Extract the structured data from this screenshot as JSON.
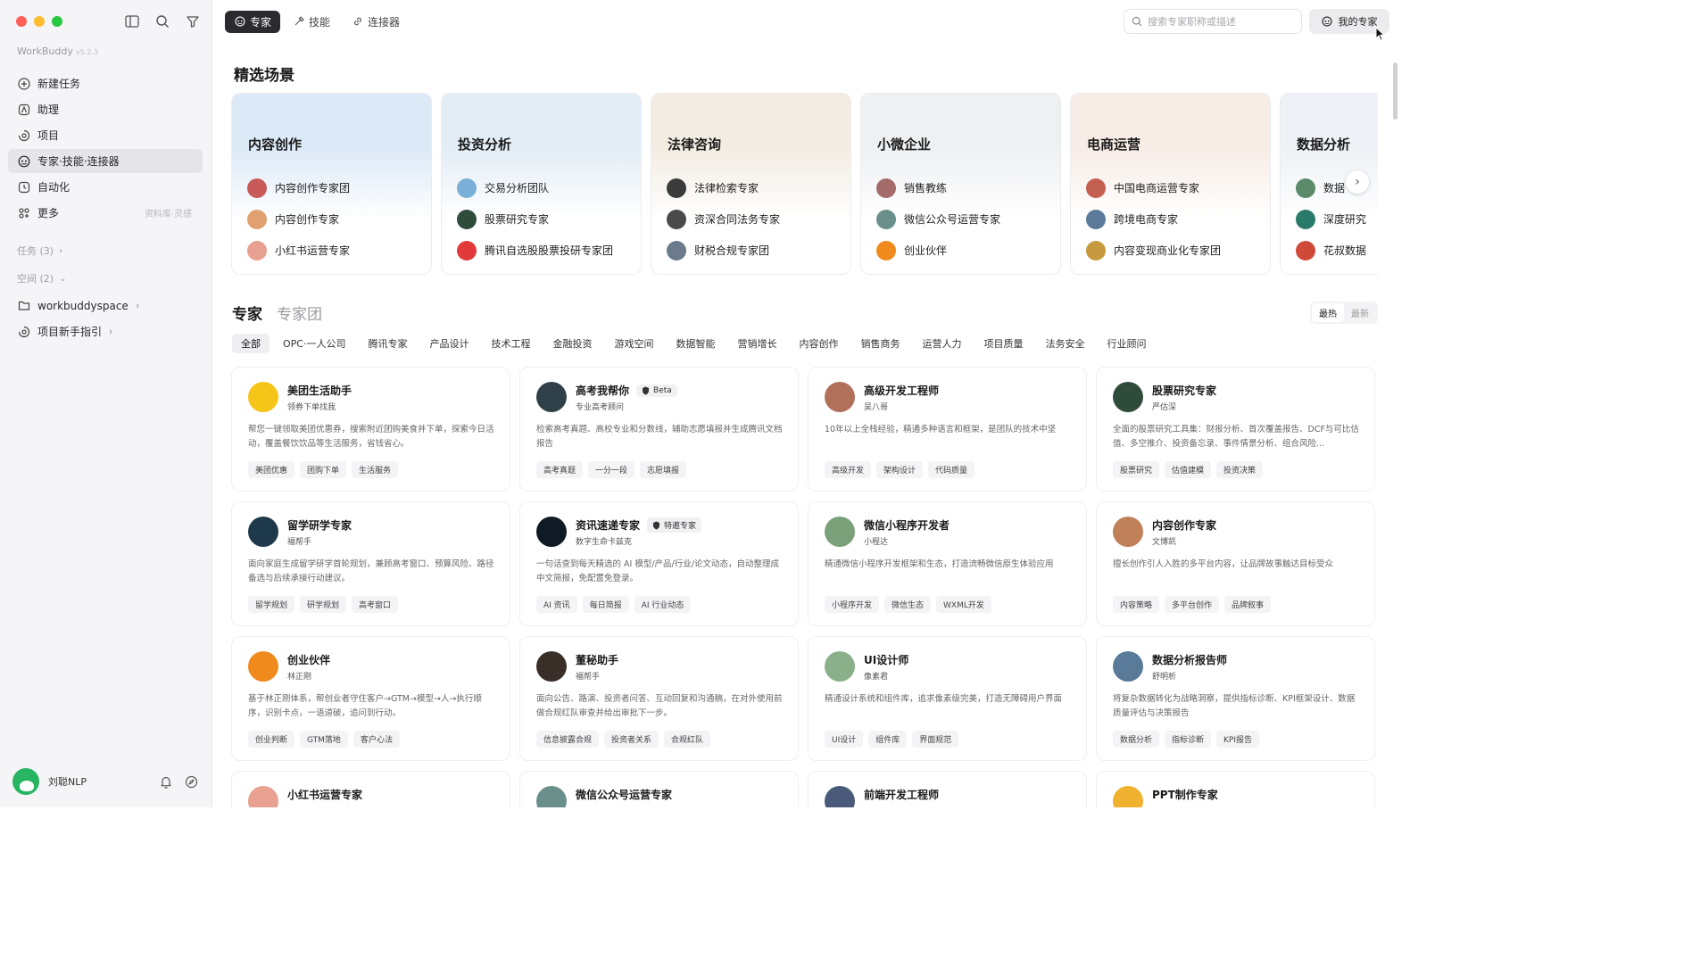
{
  "sidebar": {
    "brand": "WorkBuddy",
    "version": "v5.2.3",
    "nav": [
      {
        "label": "新建任务",
        "icon": "plus-circle-icon"
      },
      {
        "label": "助理",
        "icon": "assistant-icon"
      },
      {
        "label": "项目",
        "icon": "project-icon"
      },
      {
        "label": "专家·技能·连接器",
        "icon": "expert-icon",
        "active": true
      },
      {
        "label": "自动化",
        "icon": "automation-icon"
      },
      {
        "label": "更多",
        "icon": "more-icon",
        "hint": "资料库·灵感"
      }
    ],
    "tasks_label": "任务 (3)",
    "spaces_label": "空间 (2)",
    "workspaces": [
      {
        "label": "workbuddyspace",
        "icon": "folder-icon"
      },
      {
        "label": "项目新手指引",
        "icon": "project-icon"
      }
    ],
    "user": {
      "name": "刘聪NLP"
    }
  },
  "topbar": {
    "tabs": [
      {
        "label": "专家",
        "icon": "expert-icon",
        "active": true
      },
      {
        "label": "技能",
        "icon": "skill-icon"
      },
      {
        "label": "连接器",
        "icon": "link-icon"
      }
    ],
    "search_placeholder": "搜索专家职称或描述",
    "my_experts": "我的专家"
  },
  "featured": {
    "title": "精选场景",
    "scenes": [
      {
        "title": "内容创作",
        "color": "#dce9f7",
        "items": [
          {
            "name": "内容创作专家团",
            "color": "#c85a5a"
          },
          {
            "name": "内容创作专家",
            "color": "#e0a070"
          },
          {
            "name": "小红书运营专家",
            "color": "#e8a090"
          }
        ]
      },
      {
        "title": "投资分析",
        "color": "#e3edf5",
        "items": [
          {
            "name": "交易分析团队",
            "color": "#7ab0d8"
          },
          {
            "name": "股票研究专家",
            "color": "#2f4b3a"
          },
          {
            "name": "腾讯自选股股票投研专家团",
            "color": "#e23a3a"
          }
        ]
      },
      {
        "title": "法律咨询",
        "color": "#f3ece3",
        "items": [
          {
            "name": "法律检索专家",
            "color": "#3b3b3b"
          },
          {
            "name": "资深合同法务专家",
            "color": "#4a4a4a"
          },
          {
            "name": "财税合规专家团",
            "color": "#6b7b8b"
          }
        ]
      },
      {
        "title": "小微企业",
        "color": "#eef0f2",
        "items": [
          {
            "name": "销售教练",
            "color": "#a46b6b"
          },
          {
            "name": "微信公众号运营专家",
            "color": "#6a8f8a"
          },
          {
            "name": "创业伙伴",
            "color": "#f08a1c"
          }
        ]
      },
      {
        "title": "电商运营",
        "color": "#f7ece6",
        "items": [
          {
            "name": "中国电商运营专家",
            "color": "#c46050"
          },
          {
            "name": "跨境电商专家",
            "color": "#5a7a9a"
          },
          {
            "name": "内容变现商业化专家团",
            "color": "#c89a40"
          }
        ]
      },
      {
        "title": "数据分析",
        "color": "#eef1f5",
        "items": [
          {
            "name": "数据",
            "color": "#5a8a6a"
          },
          {
            "name": "深度研究",
            "color": "#2a7a6a"
          },
          {
            "name": "花叔数据",
            "color": "#d04a3a"
          }
        ]
      }
    ]
  },
  "experts_section": {
    "tab_experts": "专家",
    "tab_teams": "专家团",
    "sort_hot": "最热",
    "sort_new": "最新",
    "categories": [
      "全部",
      "OPC·一人公司",
      "腾讯专家",
      "产品设计",
      "技术工程",
      "金融投资",
      "游戏空间",
      "数据智能",
      "营销增长",
      "内容创作",
      "销售商务",
      "运营人力",
      "项目质量",
      "法务安全",
      "行业顾问"
    ]
  },
  "experts": [
    {
      "name": "美团生活助手",
      "sub": "领券下单找我",
      "desc": "帮您一键领取美团优惠券，搜索附近团购美食并下单，探索今日活动，覆盖餐饮饮品等生活服务，省钱省心。",
      "tags": [
        "美团优惠",
        "团购下单",
        "生活服务"
      ],
      "color": "#f5c518"
    },
    {
      "name": "高考我帮你",
      "badge": "Beta",
      "sub": "专业高考顾问",
      "desc": "检索高考真题、高校专业和分数线，辅助志愿填报并生成腾讯文档报告",
      "tags": [
        "高考真题",
        "一分一段",
        "志愿填报"
      ],
      "color": "#2f4048"
    },
    {
      "name": "高级开发工程师",
      "sub": "吴八哥",
      "desc": "10年以上全栈经验，精通多种语言和框架，是团队的技术中坚",
      "tags": [
        "高级开发",
        "架构设计",
        "代码质量"
      ],
      "color": "#b0705a"
    },
    {
      "name": "股票研究专家",
      "sub": "严估深",
      "desc": "全面的股票研究工具集：财报分析、首次覆盖报告、DCF与可比估值、多空推介、投资备忘录、事件情景分析、组合风险...",
      "tags": [
        "股票研究",
        "估值建模",
        "投资决策"
      ],
      "color": "#2f4b3a"
    },
    {
      "name": "留学研学专家",
      "sub": "福帮手",
      "desc": "面向家庭生成留学研学首轮规划，兼顾高考窗口、预算风险、路径备选与后续承接行动建议。",
      "tags": [
        "留学规划",
        "研学规划",
        "高考窗口"
      ],
      "color": "#1e3a4a"
    },
    {
      "name": "资讯速递专家",
      "badge": "特邀专家",
      "sub": "数字生命卡兹克",
      "desc": "一句话查到每天精选的 AI 模型/产品/行业/论文动态，自动整理成中文简报，免配置免登录。",
      "tags": [
        "AI 资讯",
        "每日简报",
        "AI 行业动态"
      ],
      "color": "#0f1a24"
    },
    {
      "name": "微信小程序开发者",
      "sub": "小程达",
      "desc": "精通微信小程序开发框架和生态，打造流畅微信原生体验应用",
      "tags": [
        "小程序开发",
        "微信生态",
        "WXML开发"
      ],
      "color": "#7aa07a"
    },
    {
      "name": "内容创作专家",
      "sub": "文博凯",
      "desc": "擅长创作引人入胜的多平台内容，让品牌故事触达目标受众",
      "tags": [
        "内容策略",
        "多平台创作",
        "品牌叙事"
      ],
      "color": "#c0805a"
    },
    {
      "name": "创业伙伴",
      "sub": "林正刚",
      "desc": "基于林正刚体系，帮创业者守住客户→GTM→模型→人→执行顺序，识别卡点，一语道破，追问到行动。",
      "tags": [
        "创业判断",
        "GTM落地",
        "客户心法"
      ],
      "color": "#f08a1c"
    },
    {
      "name": "董秘助手",
      "sub": "福帮手",
      "desc": "面向公告、路演、投资者问答、互动回复和沟通稿，在对外使用前做合规红队审查并给出审批下一步。",
      "tags": [
        "信息披露合规",
        "投资者关系",
        "合规红队"
      ],
      "color": "#3a2e28"
    },
    {
      "name": "UI设计师",
      "sub": "像素君",
      "desc": "精通设计系统和组件库，追求像素级完美，打造无障碍用户界面",
      "tags": [
        "UI设计",
        "组件库",
        "界面规范"
      ],
      "color": "#8ab08a"
    },
    {
      "name": "数据分析报告师",
      "sub": "舒明析",
      "desc": "将复杂数据转化为战略洞察，提供指标诊断、KPI框架设计、数据质量评估与决策报告",
      "tags": [
        "数据分析",
        "指标诊断",
        "KPI报告"
      ],
      "color": "#5a7a9a"
    },
    {
      "name": "小红书运营专家",
      "sub": "",
      "desc": "",
      "tags": [],
      "color": "#e8a090"
    },
    {
      "name": "微信公众号运营专家",
      "sub": "",
      "desc": "",
      "tags": [],
      "color": "#6a8f8a"
    },
    {
      "name": "前端开发工程师",
      "sub": "",
      "desc": "",
      "tags": [],
      "color": "#4a5a7a"
    },
    {
      "name": "PPT制作专家",
      "sub": "",
      "desc": "",
      "tags": [],
      "color": "#f0b030"
    }
  ]
}
